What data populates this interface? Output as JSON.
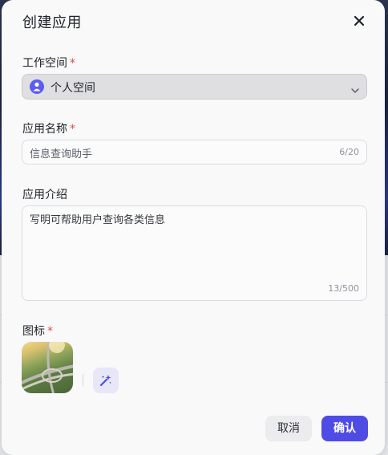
{
  "dialog": {
    "title": "创建应用",
    "close_icon": "close-icon"
  },
  "workspace": {
    "label": "工作空间",
    "required_mark": "*",
    "value": "个人空间",
    "avatar_icon": "user-icon",
    "dropdown_icon": "chevron-down-icon"
  },
  "app_name": {
    "label": "应用名称",
    "required_mark": "*",
    "value": "信息查询助手",
    "counter": "6/20"
  },
  "app_intro": {
    "label": "应用介绍",
    "value": "写明可帮助用户查询各类信息",
    "counter": "13/500"
  },
  "icon": {
    "label": "图标",
    "required_mark": "*",
    "image_icon": "app-icon-image",
    "generate_icon": "sparkle-wand-icon"
  },
  "buttons": {
    "cancel": "取消",
    "confirm": "确认"
  },
  "colors": {
    "accent": "#4f4ce6",
    "required": "#e5484d"
  }
}
